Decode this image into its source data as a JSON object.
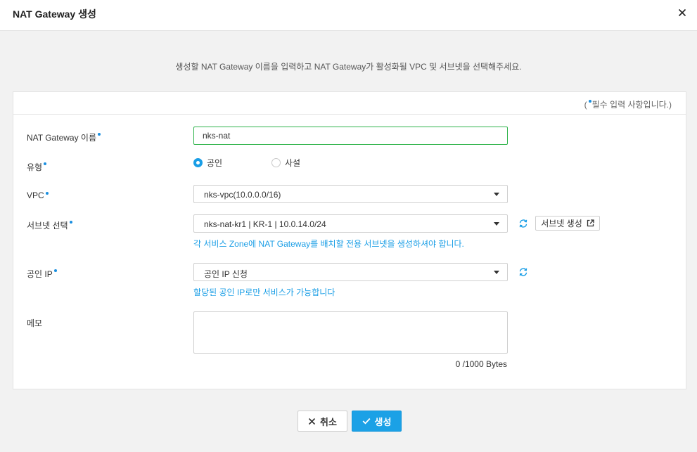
{
  "dialog": {
    "title": "NAT Gateway 생성",
    "description": "생성할 NAT Gateway 이름을 입력하고 NAT Gateway가 활성화될 VPC 및 서브넷을 선택해주세요."
  },
  "required_note": {
    "open": "(",
    "text": "필수 입력 사항입니다.)"
  },
  "form": {
    "name": {
      "label": "NAT Gateway 이름",
      "value": "nks-nat"
    },
    "type": {
      "label": "유형",
      "options": [
        {
          "label": "공인",
          "selected": true
        },
        {
          "label": "사설",
          "selected": false
        }
      ]
    },
    "vpc": {
      "label": "VPC",
      "value": "nks-vpc(10.0.0.0/16)"
    },
    "subnet": {
      "label": "서브넷 선택",
      "value": "nks-nat-kr1 | KR-1 | 10.0.14.0/24",
      "create_label": "서브넷 생성",
      "hint": "각 서비스 Zone에 NAT Gateway를 배치할 전용 서브넷을 생성하셔야 합니다."
    },
    "public_ip": {
      "label": "공인 IP",
      "value": "공인 IP 신청",
      "hint": "할당된 공인 IP로만 서비스가 가능합니다"
    },
    "memo": {
      "label": "메모",
      "value": "",
      "bytes": "0 /1000 Bytes"
    }
  },
  "footer": {
    "cancel_label": "취소",
    "create_label": "생성"
  },
  "colors": {
    "accent": "#1ba1e6",
    "required_dot": "#1a8fe0",
    "input_focus_border": "#2eb34a",
    "background": "#f2f2f2"
  },
  "icons": [
    "close-icon",
    "refresh-icon",
    "external-link-icon",
    "x-icon",
    "check-icon"
  ]
}
